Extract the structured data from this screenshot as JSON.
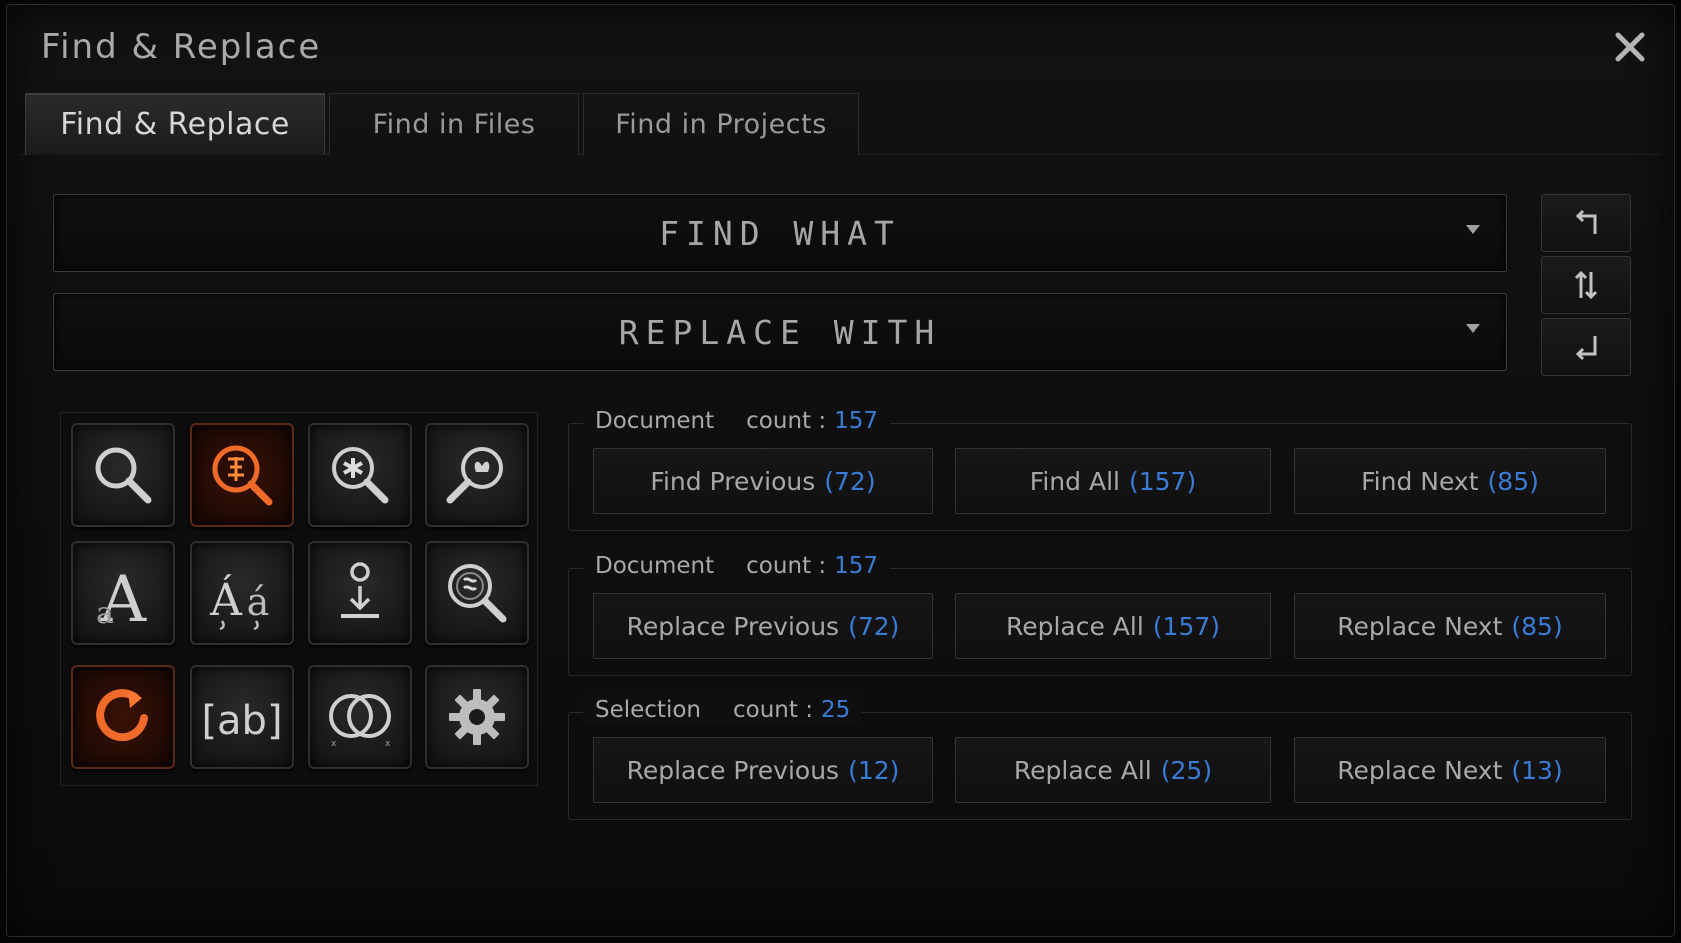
{
  "window": {
    "title": "Find & Replace"
  },
  "tabs": [
    {
      "label": "Find & Replace",
      "active": true
    },
    {
      "label": "Find in Files",
      "active": false
    },
    {
      "label": "Find in Projects",
      "active": false
    }
  ],
  "find": {
    "placeholder": "FIND WHAT",
    "value": ""
  },
  "replace": {
    "placeholder": "REPLACE WITH",
    "value": ""
  },
  "side_buttons": [
    "arrow-up-left-icon",
    "swap-vertical-icon",
    "enter-return-icon"
  ],
  "option_icons": [
    "search-icon",
    "regex-search-icon",
    "wildcard-search-icon",
    "extended-search-icon",
    "match-case-icon",
    "diacritics-icon",
    "anchor-icon",
    "special-search-icon",
    "wrap-around-icon",
    "whole-word-icon",
    "intersect-icon",
    "settings-icon"
  ],
  "groups": [
    {
      "scope": "Document",
      "count_label": "count :",
      "count": "157",
      "buttons": [
        {
          "label": "Find Previous",
          "count": "(72)"
        },
        {
          "label": "Find All",
          "count": "(157)"
        },
        {
          "label": "Find Next",
          "count": "(85)"
        }
      ]
    },
    {
      "scope": "Document",
      "count_label": "count :",
      "count": "157",
      "buttons": [
        {
          "label": "Replace Previous",
          "count": "(72)"
        },
        {
          "label": "Replace All",
          "count": "(157)"
        },
        {
          "label": "Replace Next",
          "count": "(85)"
        }
      ]
    },
    {
      "scope": "Selection",
      "count_label": "count :",
      "count": "25",
      "buttons": [
        {
          "label": "Replace Previous",
          "count": "(12)"
        },
        {
          "label": "Replace All",
          "count": "(25)"
        },
        {
          "label": "Replace Next",
          "count": "(13)"
        }
      ]
    }
  ],
  "colors": {
    "accent_blue": "#3a7bd5",
    "accent_orange": "#e8561a"
  }
}
